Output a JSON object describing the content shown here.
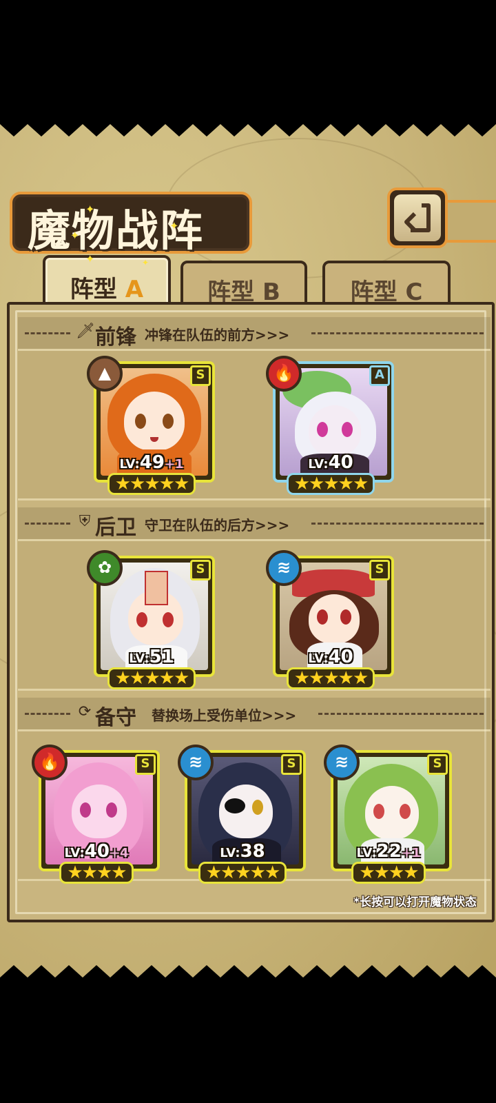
{
  "title": "魔物战阵",
  "back_button": {
    "icon": "back-arrow-icon"
  },
  "tabs": [
    {
      "prefix": "阵型",
      "letter": "A",
      "active": true
    },
    {
      "prefix": "阵型",
      "letter": "B",
      "active": false
    },
    {
      "prefix": "阵型",
      "letter": "C",
      "active": false
    }
  ],
  "sections": {
    "front": {
      "title": "前锋",
      "desc": "冲锋在队伍的前方>>>",
      "icon": "sword-icon"
    },
    "back": {
      "title": "后卫",
      "desc": "守卫在队伍的后方>>>",
      "icon": "shield-icon"
    },
    "reserve": {
      "title": "备守",
      "desc": "替换场上受伤单位>>>",
      "icon": "swap-icon"
    }
  },
  "units": {
    "front": [
      {
        "element": "earth",
        "rank": "S",
        "lv_prefix": "LV:",
        "level": "49",
        "bonus": "+1",
        "stars": "★★★★★"
      },
      {
        "element": "fire",
        "rank": "A",
        "lv_prefix": "LV:",
        "level": "40",
        "bonus": "",
        "stars": "★★★★★"
      }
    ],
    "back": [
      {
        "element": "wind",
        "rank": "S",
        "lv_prefix": "LV:",
        "level": "51",
        "bonus": "",
        "stars": "★★★★★"
      },
      {
        "element": "water",
        "rank": "S",
        "lv_prefix": "LV:",
        "level": "40",
        "bonus": "",
        "stars": "★★★★★"
      }
    ],
    "reserve": [
      {
        "element": "fire",
        "rank": "S",
        "lv_prefix": "LV:",
        "level": "40",
        "bonus": "+4",
        "stars": "★★★★"
      },
      {
        "element": "water",
        "rank": "S",
        "lv_prefix": "LV:",
        "level": "38",
        "bonus": "",
        "stars": "★★★★★"
      },
      {
        "element": "water",
        "rank": "S",
        "lv_prefix": "LV:",
        "level": "22",
        "bonus": "+1",
        "stars": "★★★★"
      }
    ]
  },
  "footer_note": "*长按可以打开魔物状态",
  "colors": {
    "frame_gold": "#e8e43a",
    "frame_blue": "#8fd6ec",
    "panel_border": "#e89a3a",
    "ink": "#3b2a1a"
  }
}
